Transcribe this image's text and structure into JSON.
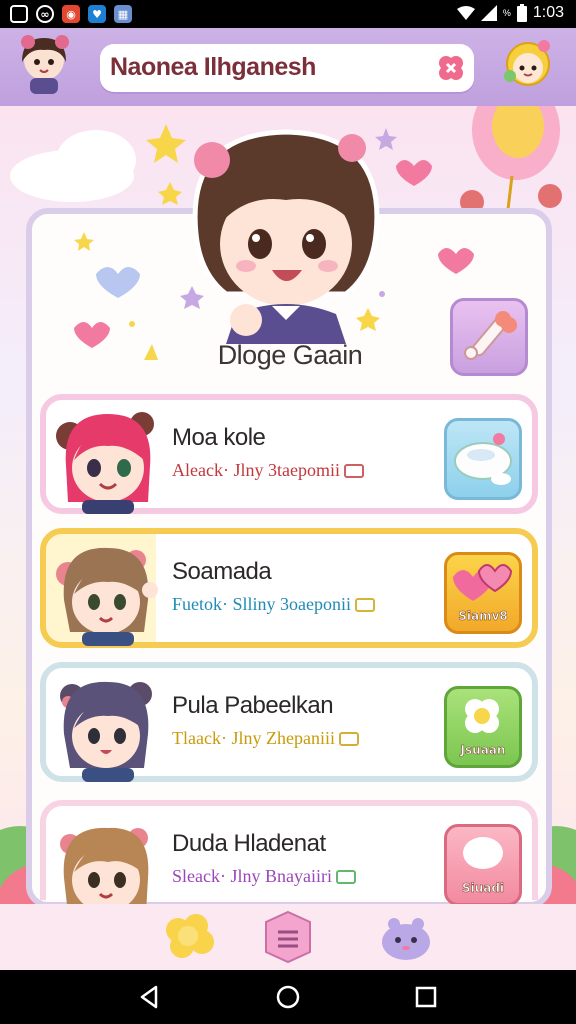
{
  "status_bar": {
    "time": "1:03",
    "battery_percent": "%",
    "left_icons": [
      "screenshot-icon",
      "sync-icon",
      "alert-icon",
      "shield-icon",
      "gallery-icon"
    ]
  },
  "header": {
    "title": "Naonea Ilhganesh"
  },
  "hero": {
    "title": "Dloge Gaain"
  },
  "cards": [
    {
      "name": "Moa kole",
      "sub": "Aleack· Jlny 3taepomii",
      "sub_color": "#c2383c",
      "action_label": ""
    },
    {
      "name": "Soamada",
      "sub": "Fuetok· Slliny 3oaeponii",
      "sub_color": "#1f8cb6",
      "action_label": "Siamv8"
    },
    {
      "name": "Pula Pabeelkan",
      "sub": "Tlaack· Jlny Zhepaniii",
      "sub_color": "#c99a09",
      "action_label": "Jsuaan"
    },
    {
      "name": "Duda Hladenat",
      "sub": "Sleack· Jlny Bnayaiiri",
      "sub_color": "#9a47b8",
      "action_label": "Siuadi"
    }
  ],
  "colors": {
    "header_bg": "#c6a9e2",
    "title_text": "#7a2f3a",
    "panel_border": "#d9cdea"
  }
}
